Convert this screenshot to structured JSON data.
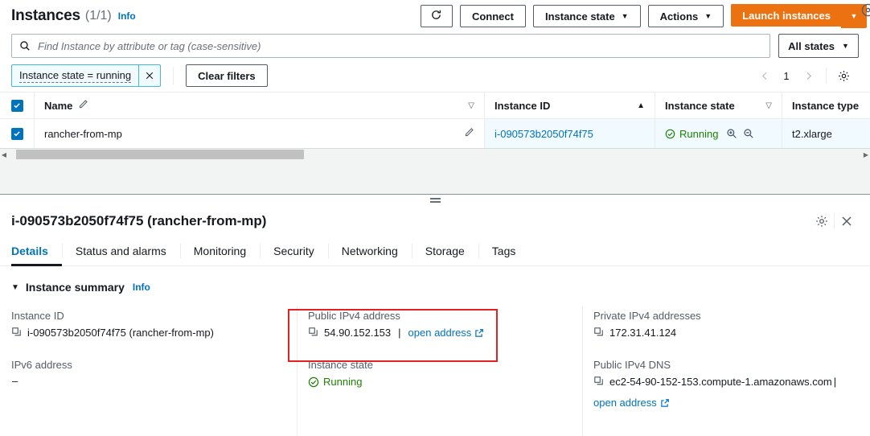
{
  "header": {
    "title": "Instances",
    "count": "(1/1)",
    "info": "Info",
    "refresh_icon": "refresh-icon",
    "connect_label": "Connect",
    "instance_state_label": "Instance state",
    "actions_label": "Actions",
    "launch_label": "Launch instances",
    "caret": "▼"
  },
  "search": {
    "placeholder": "Find Instance by attribute or tag (case-sensitive)",
    "value": "",
    "icon": "search-icon",
    "states_label": "All states"
  },
  "filters": {
    "token_label": "Instance state = running",
    "token_remove_icon": "close-icon",
    "clear_label": "Clear filters",
    "prev_icon": "chevron-left-icon",
    "page": "1",
    "next_icon": "chevron-right-icon",
    "settings_icon": "gear-icon"
  },
  "table": {
    "columns": [
      {
        "label": "Name",
        "sort": "none"
      },
      {
        "label": "Instance ID",
        "sort": "asc"
      },
      {
        "label": "Instance state",
        "sort": "none"
      },
      {
        "label": "Instance type",
        "sort": "none"
      }
    ],
    "sort_asc_glyph": "▲",
    "sort_none_glyph": "▽",
    "rows": [
      {
        "selected": true,
        "name": "rancher-from-mp",
        "instance_id": "i-090573b2050f74f75",
        "state": "Running",
        "type": "t2.xlarge"
      }
    ]
  },
  "detail": {
    "title": "i-090573b2050f74f75 (rancher-from-mp)",
    "settings_icon": "gear-icon",
    "close_icon": "close-icon",
    "tabs": [
      {
        "label": "Details",
        "active": true
      },
      {
        "label": "Status and alarms",
        "active": false
      },
      {
        "label": "Monitoring",
        "active": false
      },
      {
        "label": "Security",
        "active": false
      },
      {
        "label": "Networking",
        "active": false
      },
      {
        "label": "Storage",
        "active": false
      },
      {
        "label": "Tags",
        "active": false
      }
    ],
    "summary": {
      "title": "Instance summary",
      "info": "Info",
      "fields": {
        "instance_id_label": "Instance ID",
        "instance_id_value": "i-090573b2050f74f75 (rancher-from-mp)",
        "ipv6_label": "IPv6 address",
        "ipv6_value": "–",
        "public_ipv4_label": "Public IPv4 address",
        "public_ipv4_value": "54.90.152.153",
        "public_ipv4_link": "open address",
        "instance_state_label": "Instance state",
        "instance_state_value": "Running",
        "private_ipv4_label": "Private IPv4 addresses",
        "private_ipv4_value": "172.31.41.124",
        "public_dns_label": "Public IPv4 DNS",
        "public_dns_value": "ec2-54-90-152-153.compute-1.amazonaws.com",
        "public_dns_link": "open address",
        "pipe": "|"
      }
    }
  },
  "colors": {
    "accent": "#0073bb",
    "brand_orange": "#ec7211",
    "running_green": "#1d8102",
    "highlight_red": "#e52020"
  }
}
